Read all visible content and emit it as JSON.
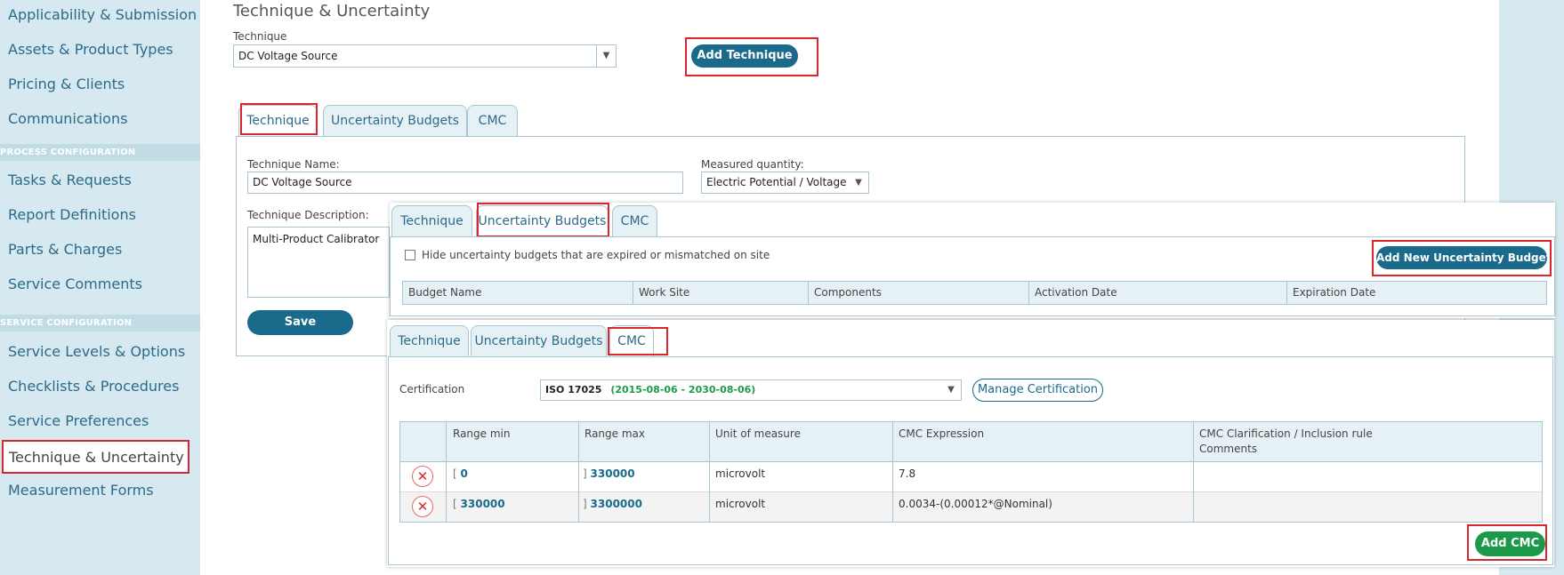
{
  "sidebar": {
    "items_top": [
      "Applicability & Submission",
      "Assets & Product Types",
      "Pricing & Clients",
      "Communications"
    ],
    "section_process": "PROCESS CONFIGURATION",
    "items_process": [
      "Tasks & Requests",
      "Report Definitions",
      "Parts & Charges",
      "Service Comments"
    ],
    "section_service": "SERVICE CONFIGURATION",
    "items_service": [
      "Service Levels & Options",
      "Checklists & Procedures",
      "Service Preferences"
    ],
    "active_item": "Technique & Uncertainty",
    "items_bottom": [
      "Measurement Forms"
    ]
  },
  "page": {
    "title": "Technique & Uncertainty",
    "technique_label": "Technique",
    "technique_value": "DC Voltage Source",
    "add_technique_label": "Add Technique"
  },
  "tabs": [
    "Technique",
    "Uncertainty Budgets",
    "CMC"
  ],
  "technique_form": {
    "name_label": "Technique Name:",
    "name_value": "DC Voltage Source",
    "quantity_label": "Measured quantity:",
    "quantity_value": "Electric Potential / Voltage",
    "description_label": "Technique Description:",
    "description_value": "Multi-Product Calibrator",
    "save_label": "Save"
  },
  "uncertainty": {
    "hide_label": "Hide uncertainty budgets that are expired or mismatched on site",
    "add_label": "Add New Uncertainty Budget",
    "columns": [
      "Budget Name",
      "Work Site",
      "Components",
      "Activation Date",
      "Expiration Date"
    ]
  },
  "cmc": {
    "certification_label": "Certification",
    "certification_name": "ISO 17025",
    "certification_dates": "(2015-08-06 - 2030-08-06)",
    "manage_label": "Manage Certification",
    "columns": [
      "Range min",
      "Range max",
      "Unit of measure",
      "CMC Expression",
      "CMC Clarification / Inclusion rule",
      "Comments"
    ],
    "rows": [
      {
        "min_bracket": "[",
        "min": "0",
        "max_bracket": "]",
        "max": "330000",
        "unit": "microvolt",
        "expression": "7.8"
      },
      {
        "min_bracket": "[",
        "min": "330000",
        "max_bracket": "]",
        "max": "3300000",
        "unit": "microvolt",
        "expression": "0.0034-(0.00012*@Nominal)"
      }
    ],
    "add_label": "Add CMC"
  },
  "icons": {
    "dropdown": "chevron-down-icon",
    "delete": "delete-icon"
  },
  "colors": {
    "accent": "#1a6a8c",
    "highlight": "#d9262c",
    "success": "#1c9a4a",
    "sidebar": "#d7e9f0"
  }
}
